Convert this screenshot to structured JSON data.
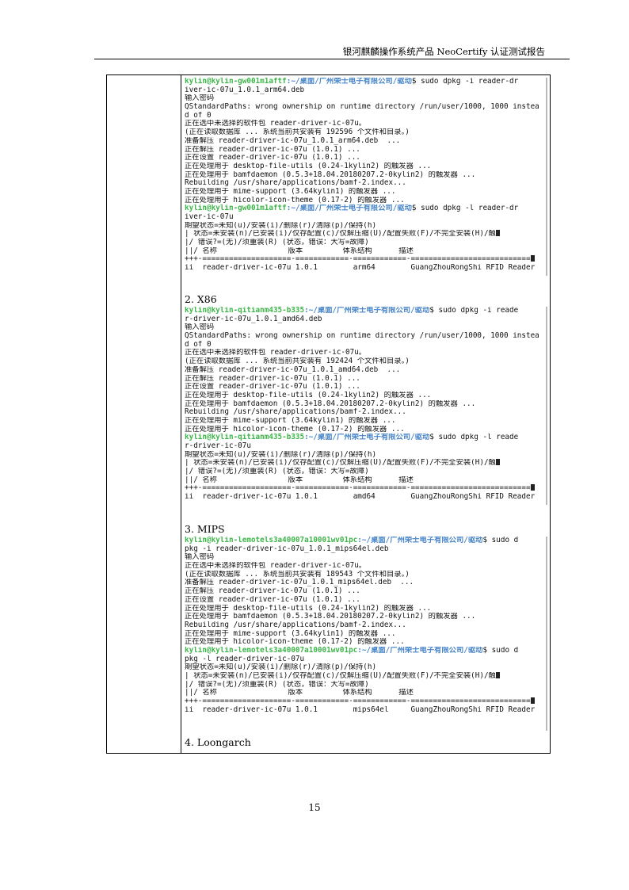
{
  "header": {
    "title": "银河麒麟操作系统产品 NeoCertify 认证测试报告"
  },
  "page_number": "15",
  "sections": [
    {
      "label": "",
      "lines": [
        {
          "user": "kylin@kylin-gw001m1aftf",
          "path": ":~/桌面/广州荣士电子有限公司/驱动",
          "text": "$ sudo dpkg -i reader-dr"
        },
        {
          "text": "iver-ic-07u_1.0.1_arm64.deb"
        },
        {
          "text": "输入密码"
        },
        {
          "text": "QStandardPaths: wrong ownership on runtime directory /run/user/1000, 1000 instea"
        },
        {
          "text": "d of 0"
        },
        {
          "text": "正在选中未选择的软件包 reader-driver-ic-07u。"
        },
        {
          "text": "(正在读取数据库 ... 系统当前共安装有 192596 个文件和目录。)"
        },
        {
          "text": "准备解压 reader-driver-ic-07u_1.0.1_arm64.deb  ..."
        },
        {
          "text": "正在解压 reader-driver-ic-07u (1.0.1) ..."
        },
        {
          "text": "正在设置 reader-driver-ic-07u (1.0.1) ..."
        },
        {
          "text": "正在处理用于 desktop-file-utils (0.24-1kylin2) 的触发器 ..."
        },
        {
          "text": "正在处理用于 bamfdaemon (0.5.3+18.04.20180207.2-0kylin2) 的触发器 ..."
        },
        {
          "text": "Rebuilding /usr/share/applications/bamf-2.index..."
        },
        {
          "text": "正在处理用于 mime-support (3.64kylin1) 的触发器 ..."
        },
        {
          "text": "正在处理用于 hicolor-icon-theme (0.17-2) 的触发器 ..."
        },
        {
          "user": "kylin@kylin-gw001m1aftf",
          "path": ":~/桌面/广州荣士电子有限公司/驱动",
          "text": "$ sudo dpkg -l reader-dr"
        },
        {
          "text": "iver-ic-07u"
        },
        {
          "text": "期望状态=未知(u)/安装(i)/删除(r)/清除(p)/保持(h)"
        },
        {
          "text": "| 状态=未安装(n)/已安装(i)/仅存配置(c)/仅解压缩(U)/配置失败(F)/不完全安装(H)/触",
          "mark": true
        },
        {
          "text": "|/ 错误?=(无)/须重装(R) (状态，错误：大写=故障)"
        },
        {
          "text": "||/ 名称                版本         体系结构      描述"
        },
        {
          "text": "+++-====================-============-============-===========================",
          "mark": true
        },
        {
          "text": "ii  reader-driver-ic-07u 1.0.1        arm64        GuangZhouRongShi RFID Reader"
        }
      ]
    },
    {
      "label": "2.  X86",
      "lines": [
        {
          "user": "kylin@kylin-qitianm435-b335",
          "path": ":~/桌面/广州荣士电子有限公司/驱动",
          "text": "$ sudo dpkg -i reade"
        },
        {
          "text": "r-driver-ic-07u_1.0.1_amd64.deb"
        },
        {
          "text": "输入密码"
        },
        {
          "text": "QStandardPaths: wrong ownership on runtime directory /run/user/1000, 1000 instea"
        },
        {
          "text": "d of 0"
        },
        {
          "text": "正在选中未选择的软件包 reader-driver-ic-07u。"
        },
        {
          "text": "(正在读取数据库 ... 系统当前共安装有 192424 个文件和目录。)"
        },
        {
          "text": "准备解压 reader-driver-ic-07u_1.0.1_amd64.deb  ..."
        },
        {
          "text": "正在解压 reader-driver-ic-07u (1.0.1) ..."
        },
        {
          "text": "正在设置 reader-driver-ic-07u (1.0.1) ..."
        },
        {
          "text": "正在处理用于 desktop-file-utils (0.24-1kylin2) 的触发器 ..."
        },
        {
          "text": "正在处理用于 bamfdaemon (0.5.3+18.04.20180207.2-0kylin2) 的触发器 ..."
        },
        {
          "text": "Rebuilding /usr/share/applications/bamf-2.index..."
        },
        {
          "text": "正在处理用于 mime-support (3.64kylin1) 的触发器 ..."
        },
        {
          "text": "正在处理用于 hicolor-icon-theme (0.17-2) 的触发器 ..."
        },
        {
          "user": "kylin@kylin-qitianm435-b335",
          "path": ":~/桌面/广州荣士电子有限公司/驱动",
          "text": "$ sudo dpkg -l reade"
        },
        {
          "text": "r-driver-ic-07u"
        },
        {
          "text": "期望状态=未知(u)/安装(i)/删除(r)/清除(p)/保持(h)"
        },
        {
          "text": "| 状态=未安装(n)/已安装(i)/仅存配置(c)/仅解压缩(U)/配置失败(F)/不完全安装(H)/触",
          "mark": true
        },
        {
          "text": "|/ 错误?=(无)/须重装(R) (状态，错误：大写=故障)"
        },
        {
          "text": "||/ 名称                版本         体系结构      描述"
        },
        {
          "text": "+++-====================-============-============-===========================",
          "mark": true
        },
        {
          "text": "ii  reader-driver-ic-07u 1.0.1        amd64        GuangZhouRongShi RFID Reader"
        }
      ]
    },
    {
      "label": "3.  MIPS",
      "lines": [
        {
          "user": "kylin@kylin-lemotels3a40007a10001wv01pc",
          "path": ":~/桌面/广州荣士电子有限公司/驱动",
          "text": "$ sudo d"
        },
        {
          "text": "pkg -i reader-driver-ic-07u_1.0.1_mips64el.deb"
        },
        {
          "text": "输入密码"
        },
        {
          "text": "正在选中未选择的软件包 reader-driver-ic-07u。"
        },
        {
          "text": "(正在读取数据库 ... 系统当前共安装有 189543 个文件和目录。)"
        },
        {
          "text": "准备解压 reader-driver-ic-07u_1.0.1_mips64el.deb  ..."
        },
        {
          "text": "正在解压 reader-driver-ic-07u (1.0.1) ..."
        },
        {
          "text": "正在设置 reader-driver-ic-07u (1.0.1) ..."
        },
        {
          "text": "正在处理用于 desktop-file-utils (0.24-1kylin2) 的触发器 ..."
        },
        {
          "text": "正在处理用于 bamfdaemon (0.5.3+18.04.20180207.2-0kylin2) 的触发器 ..."
        },
        {
          "text": "Rebuilding /usr/share/applications/bamf-2.index..."
        },
        {
          "text": "正在处理用于 mime-support (3.64kylin1) 的触发器 ..."
        },
        {
          "text": "正在处理用于 hicolor-icon-theme (0.17-2) 的触发器 ..."
        },
        {
          "user": "kylin@kylin-lemotels3a40007a10001wv01pc",
          "path": ":~/桌面/广州荣士电子有限公司/驱动",
          "text": "$ sudo d"
        },
        {
          "text": "pkg -l reader-driver-ic-07u"
        },
        {
          "text": "期望状态=未知(u)/安装(i)/删除(r)/清除(p)/保持(h)"
        },
        {
          "text": "| 状态=未安装(n)/已安装(i)/仅存配置(c)/仅解压缩(U)/配置失败(F)/不完全安装(H)/触",
          "mark": true
        },
        {
          "text": "|/ 错误?=(无)/须重装(R) (状态，错误：大写=故障)"
        },
        {
          "text": "||/ 名称                版本         体系结构      描述"
        },
        {
          "text": "+++-====================-============-============-===========================",
          "mark": true
        },
        {
          "text": "ii  reader-driver-ic-07u 1.0.1        mips64el     GuangZhouRongShi RFID Reader"
        }
      ]
    },
    {
      "label": "4.  Loongarch",
      "lines": []
    }
  ]
}
